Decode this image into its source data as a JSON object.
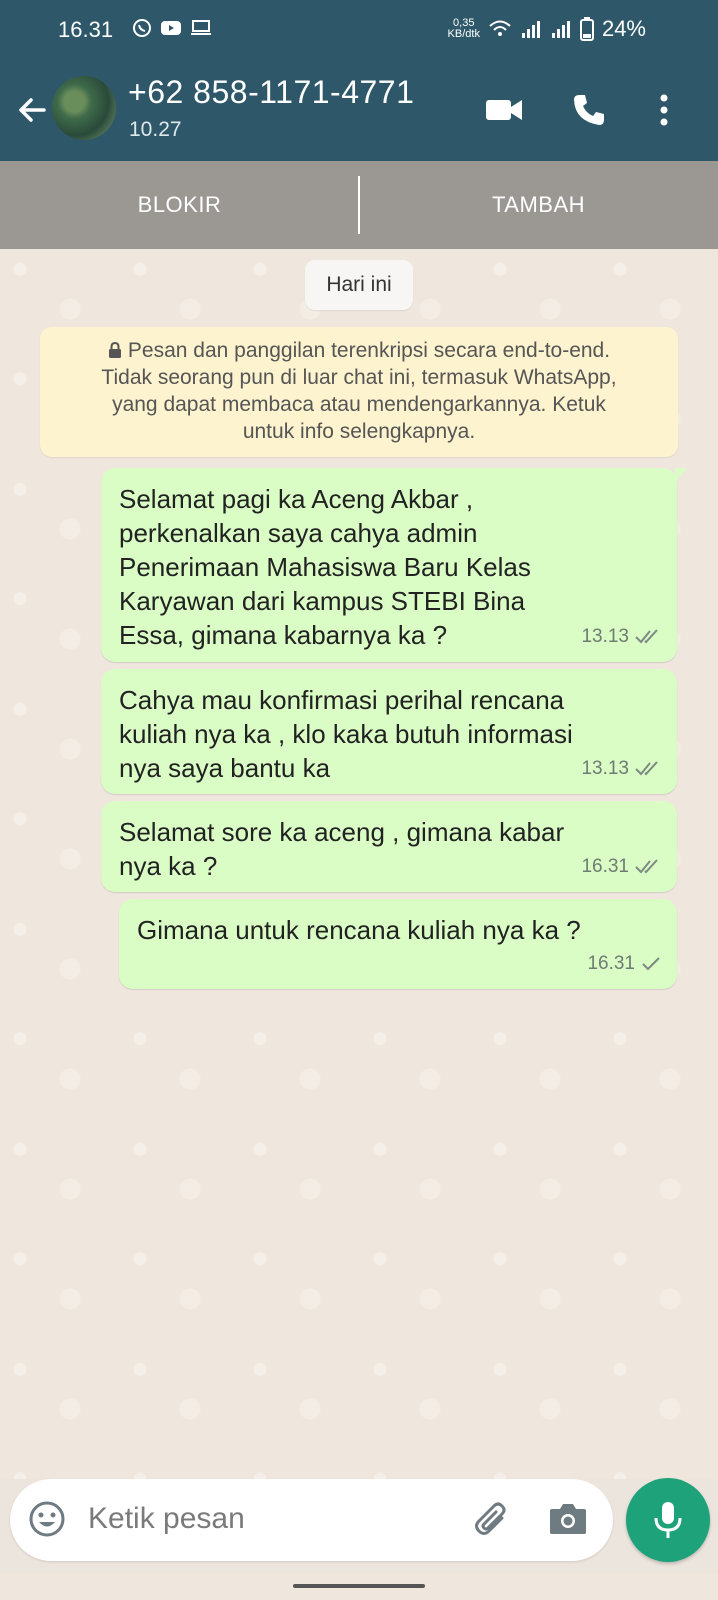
{
  "status_bar": {
    "time": "16.31",
    "speed_value": "0,35",
    "speed_unit": "KB/dtk",
    "battery": "24%"
  },
  "header": {
    "contact_name": "+62 858-1171-4771",
    "subtitle": "10.27",
    "colors": {
      "header": "#2e5869",
      "accent": "#1da27a"
    }
  },
  "action_bar": {
    "block_label": "BLOKIR",
    "add_label": "TAMBAH"
  },
  "chat": {
    "date_chip": "Hari ini",
    "encryption_notice": {
      "line1": "Pesan dan panggilan terenkripsi secara end-to-end.",
      "line2": "Tidak seorang pun di luar chat ini, termasuk WhatsApp,",
      "line3": "yang dapat membaca atau mendengarkannya. Ketuk",
      "line4": "untuk info selengkapnya."
    },
    "messages": [
      {
        "lines": [
          "Selamat pagi ka Aceng Akbar ,",
          "perkenalkan saya cahya admin",
          "Penerimaan Mahasiswa Baru Kelas",
          "Karyawan dari kampus STEBI Bina",
          "Essa, gimana kabarnya ka ?"
        ],
        "time": "13.13",
        "status": "double-check-icon"
      },
      {
        "lines": [
          "Cahya mau konfirmasi perihal rencana",
          "kuliah nya ka , klo kaka butuh informasi",
          "nya saya bantu ka"
        ],
        "time": "13.13",
        "status": "double-check-icon"
      },
      {
        "lines": [
          "Selamat sore ka aceng , gimana kabar",
          "nya ka ?"
        ],
        "time": "16.31",
        "status": "double-check-icon"
      },
      {
        "lines": [
          "Gimana untuk rencana kuliah nya ka ?"
        ],
        "time": "16.31",
        "status": "single-check-icon"
      }
    ]
  },
  "input": {
    "placeholder": "Ketik pesan"
  }
}
